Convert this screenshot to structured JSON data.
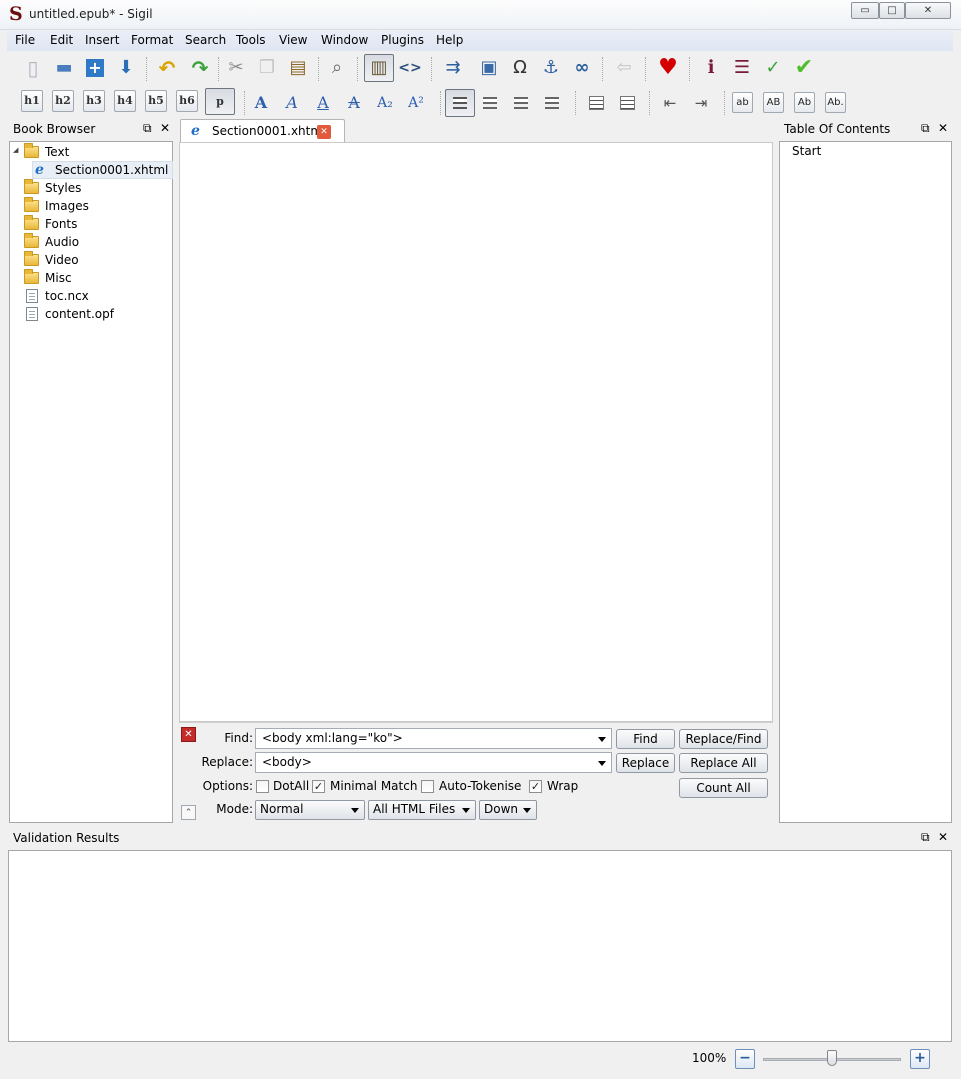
{
  "window": {
    "title": "untitled.epub* - Sigil",
    "minimize": "▭",
    "maximize": "□",
    "close": "✕"
  },
  "menu": [
    "File",
    "Edit",
    "Insert",
    "Format",
    "Search",
    "Tools",
    "View",
    "Window",
    "Plugins",
    "Help"
  ],
  "toolbar_main": [
    {
      "icon": "new-file-icon",
      "glyph": "▯",
      "color": "#b9c1c9"
    },
    {
      "icon": "open-folder-icon",
      "glyph": "▬",
      "color": "#4a7dbd"
    },
    {
      "icon": "add-existing-icon",
      "glyph": "+",
      "color": "#ffffff"
    },
    {
      "icon": "save-icon",
      "glyph": "⬇",
      "color": "#2d6fb5"
    },
    {
      "icon": "undo-icon",
      "glyph": "↶",
      "color": "#d9a300"
    },
    {
      "icon": "redo-icon",
      "glyph": "↷",
      "color": "#3aa23a"
    },
    {
      "icon": "cut-icon",
      "glyph": "✂",
      "color": "#8c8c8c"
    },
    {
      "icon": "copy-icon",
      "glyph": "❐",
      "color": "#c5c5c5"
    },
    {
      "icon": "paste-icon",
      "glyph": "▤",
      "color": "#8a6a2a"
    },
    {
      "icon": "find-icon",
      "glyph": "⌕",
      "color": "#6a6a6a"
    },
    {
      "icon": "book-view-icon",
      "glyph": "▥",
      "color": "#6b5a3a"
    },
    {
      "icon": "code-view-icon",
      "glyph": "<>",
      "color": "#2d4f7d"
    },
    {
      "icon": "split-file-icon",
      "glyph": "⇉",
      "color": "#2d5f9d"
    },
    {
      "icon": "insert-image-icon",
      "glyph": "▣",
      "color": "#3a6aa5"
    },
    {
      "icon": "insert-special-char-icon",
      "glyph": "Ω",
      "color": "#333333"
    },
    {
      "icon": "insert-id-anchor-icon",
      "glyph": "⚓",
      "color": "#2d5f9d"
    },
    {
      "icon": "insert-link-icon",
      "glyph": "∞",
      "color": "#2d5f9d"
    },
    {
      "icon": "go-back-icon",
      "glyph": "⇦",
      "color": "#c5c5c5"
    },
    {
      "icon": "donate-heart-icon",
      "glyph": "♥",
      "color": "#d40000"
    },
    {
      "icon": "metadata-editor-icon",
      "glyph": "ℹ",
      "color": "#7a1a3a"
    },
    {
      "icon": "toc-editor-icon",
      "glyph": "☰",
      "color": "#7a1a3a"
    },
    {
      "icon": "spellcheck-icon",
      "glyph": "✓",
      "color": "#3aa23a"
    },
    {
      "icon": "validate-icon",
      "glyph": "✔",
      "color": "#4cbf2a"
    }
  ],
  "headings": [
    "h1",
    "h2",
    "h3",
    "h4",
    "h5",
    "h6",
    "p"
  ],
  "format_glyphs": [
    "A",
    "A",
    "A",
    "A",
    "A₂",
    "A²"
  ],
  "case_buttons": [
    "ab",
    "AB",
    "Ab",
    "Ab."
  ],
  "book_browser": {
    "title": "Book Browser",
    "float": "⧉",
    "close": "✕",
    "expand": "◢",
    "items": [
      {
        "label": "Text",
        "type": "folder"
      },
      {
        "label": "Section0001.xhtml",
        "type": "html"
      },
      {
        "label": "Styles",
        "type": "folder"
      },
      {
        "label": "Images",
        "type": "folder"
      },
      {
        "label": "Fonts",
        "type": "folder"
      },
      {
        "label": "Audio",
        "type": "folder"
      },
      {
        "label": "Video",
        "type": "folder"
      },
      {
        "label": "Misc",
        "type": "folder"
      },
      {
        "label": "toc.ncx",
        "type": "file"
      },
      {
        "label": "content.opf",
        "type": "file"
      }
    ]
  },
  "editor": {
    "tab": "Section0001.xhtml",
    "tab_close": "✕"
  },
  "find_replace": {
    "close": "✕",
    "find_label": "Find:",
    "find_value": "<body xml:lang=\"ko\">",
    "replace_label": "Replace:",
    "replace_value": "<body>",
    "options_label": "Options:",
    "mode_label": "Mode:",
    "buttons": {
      "find": "Find",
      "replace_find": "Replace/Find",
      "replace": "Replace",
      "replace_all": "Replace All",
      "count_all": "Count All"
    },
    "options": [
      {
        "label": "DotAll",
        "checked": false
      },
      {
        "label": "Minimal Match",
        "checked": true
      },
      {
        "label": "Auto-Tokenise",
        "checked": false
      },
      {
        "label": "Wrap",
        "checked": true
      }
    ],
    "mode": "Normal",
    "scope": "All HTML Files",
    "direction": "Down",
    "collapse": "⌃"
  },
  "toc_panel": {
    "title": "Table Of Contents",
    "float": "⧉",
    "close": "✕",
    "items": [
      "Start"
    ]
  },
  "validation": {
    "title": "Validation Results",
    "float": "⧉",
    "close": "✕"
  },
  "status": {
    "zoom": "100%",
    "zoom_level": 0.5,
    "zoom_out": "−",
    "zoom_in": "+"
  }
}
